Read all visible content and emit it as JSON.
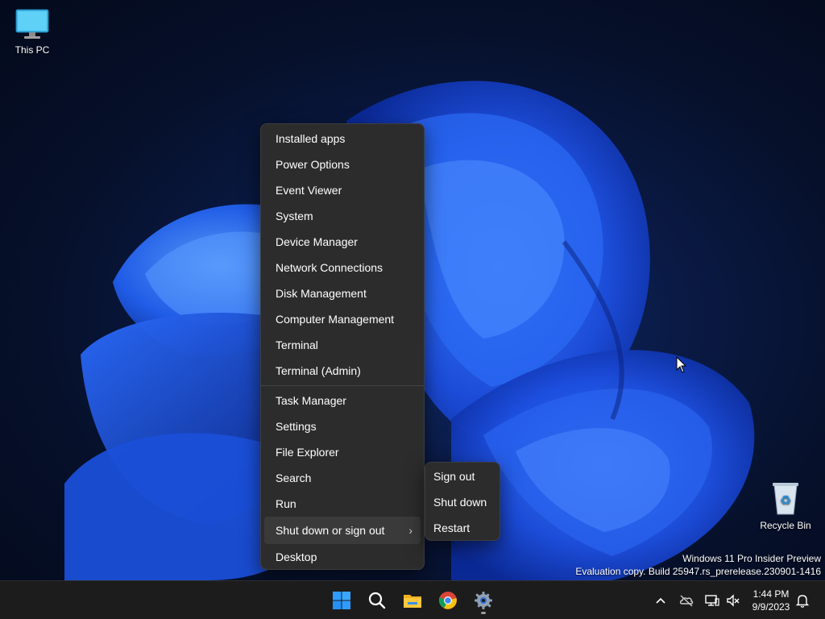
{
  "desktop": {
    "icons": [
      {
        "label": "This PC",
        "icon": "monitor-icon"
      },
      {
        "label": "Recycle Bin",
        "icon": "recycle-bin-icon"
      }
    ],
    "watermark": {
      "line1": "Windows 11 Pro Insider Preview",
      "line2": "Evaluation copy. Build 25947.rs_prerelease.230901-1416"
    }
  },
  "context_menu": {
    "group1": [
      {
        "label": "Installed apps"
      },
      {
        "label": "Power Options"
      },
      {
        "label": "Event Viewer"
      },
      {
        "label": "System"
      },
      {
        "label": "Device Manager"
      },
      {
        "label": "Network Connections"
      },
      {
        "label": "Disk Management"
      },
      {
        "label": "Computer Management"
      },
      {
        "label": "Terminal"
      },
      {
        "label": "Terminal (Admin)"
      }
    ],
    "group2": [
      {
        "label": "Task Manager"
      },
      {
        "label": "Settings"
      },
      {
        "label": "File Explorer"
      },
      {
        "label": "Search"
      },
      {
        "label": "Run"
      },
      {
        "label": "Shut down or sign out",
        "submenu_icon": "chevron-right-icon"
      },
      {
        "label": "Desktop"
      }
    ]
  },
  "submenu": {
    "items": [
      {
        "label": "Sign out"
      },
      {
        "label": "Shut down"
      },
      {
        "label": "Restart"
      }
    ]
  },
  "taskbar": {
    "apps": [
      "windows-start-icon",
      "search-icon",
      "file-explorer-icon",
      "chrome-icon",
      "settings-gear-icon"
    ],
    "tray": [
      "chevron-up-icon",
      "onedrive-offline-icon",
      "network-icon",
      "volume-muted-icon",
      "notification-bell-icon"
    ],
    "clock": {
      "time": "1:44 PM",
      "date": "9/9/2023"
    }
  },
  "colors": {
    "menu_bg": "#2c2c2c",
    "taskbar_bg": "#1c1c1c",
    "accent": "#1e90ff"
  }
}
